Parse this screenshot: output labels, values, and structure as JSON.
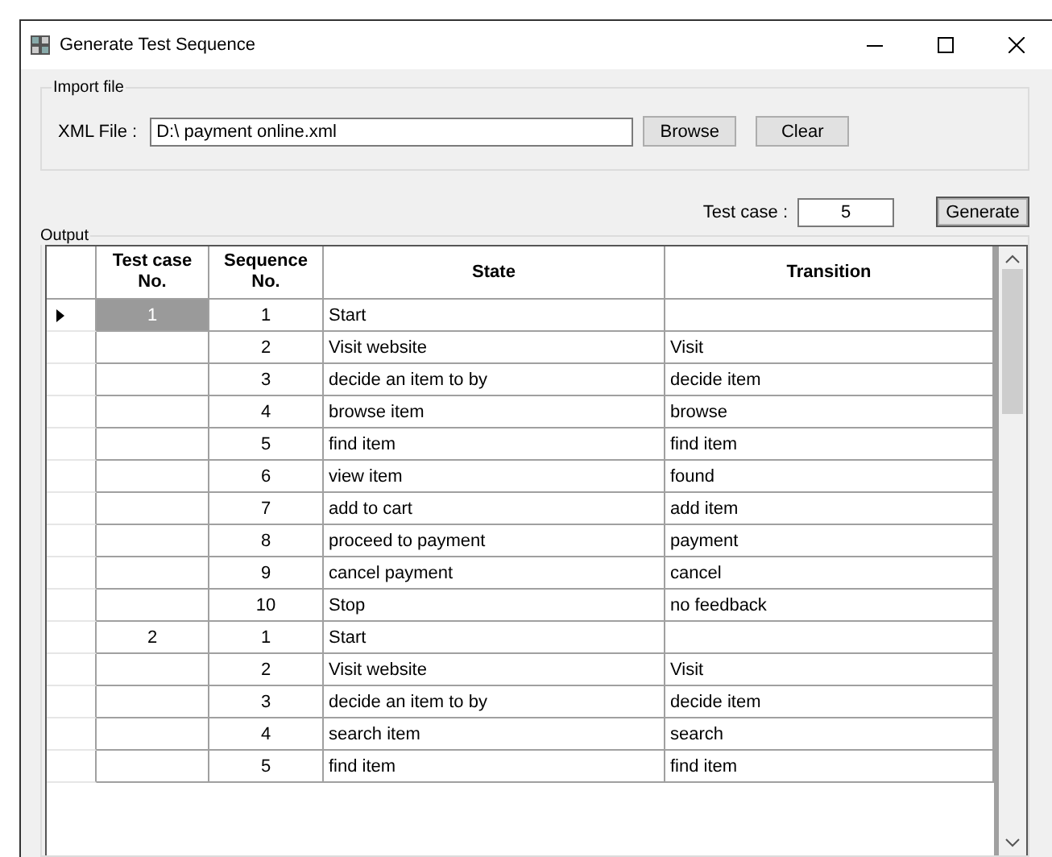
{
  "window": {
    "title": "Generate Test Sequence"
  },
  "import_file": {
    "legend": "Import file",
    "label": "XML File :",
    "value": "D:\\ payment online.xml",
    "buttons": [
      "Browse",
      "Clear"
    ]
  },
  "test_case": {
    "label": "Test case :",
    "value": "5",
    "button": "Generate"
  },
  "output": {
    "legend": "Output",
    "columns": [
      "Test case No.",
      "Sequence No.",
      "State",
      "Transition"
    ],
    "rows": [
      {
        "test_case": "1",
        "sequence": "1",
        "state": "Start",
        "transition": "",
        "selected": true,
        "current": true
      },
      {
        "test_case": "",
        "sequence": "2",
        "state": "Visit website",
        "transition": "Visit",
        "selected": false,
        "current": false
      },
      {
        "test_case": "",
        "sequence": "3",
        "state": "decide an item to by",
        "transition": "decide item",
        "selected": false,
        "current": false
      },
      {
        "test_case": "",
        "sequence": "4",
        "state": "browse item",
        "transition": "browse",
        "selected": false,
        "current": false
      },
      {
        "test_case": "",
        "sequence": "5",
        "state": "find item",
        "transition": "find item",
        "selected": false,
        "current": false
      },
      {
        "test_case": "",
        "sequence": "6",
        "state": "view item",
        "transition": "found",
        "selected": false,
        "current": false
      },
      {
        "test_case": "",
        "sequence": "7",
        "state": "add to cart",
        "transition": "add item",
        "selected": false,
        "current": false
      },
      {
        "test_case": "",
        "sequence": "8",
        "state": "proceed to payment",
        "transition": "payment",
        "selected": false,
        "current": false
      },
      {
        "test_case": "",
        "sequence": "9",
        "state": "cancel payment",
        "transition": "cancel",
        "selected": false,
        "current": false
      },
      {
        "test_case": "",
        "sequence": "10",
        "state": "Stop",
        "transition": "no feedback",
        "selected": false,
        "current": false
      },
      {
        "test_case": "2",
        "sequence": "1",
        "state": "Start",
        "transition": "",
        "selected": false,
        "current": false
      },
      {
        "test_case": "",
        "sequence": "2",
        "state": "Visit website",
        "transition": "Visit",
        "selected": false,
        "current": false
      },
      {
        "test_case": "",
        "sequence": "3",
        "state": "decide an item to by",
        "transition": "decide item",
        "selected": false,
        "current": false
      },
      {
        "test_case": "",
        "sequence": "4",
        "state": "search item",
        "transition": "search",
        "selected": false,
        "current": false
      },
      {
        "test_case": "",
        "sequence": "5",
        "state": "find item",
        "transition": "find item",
        "selected": false,
        "current": false
      }
    ]
  }
}
